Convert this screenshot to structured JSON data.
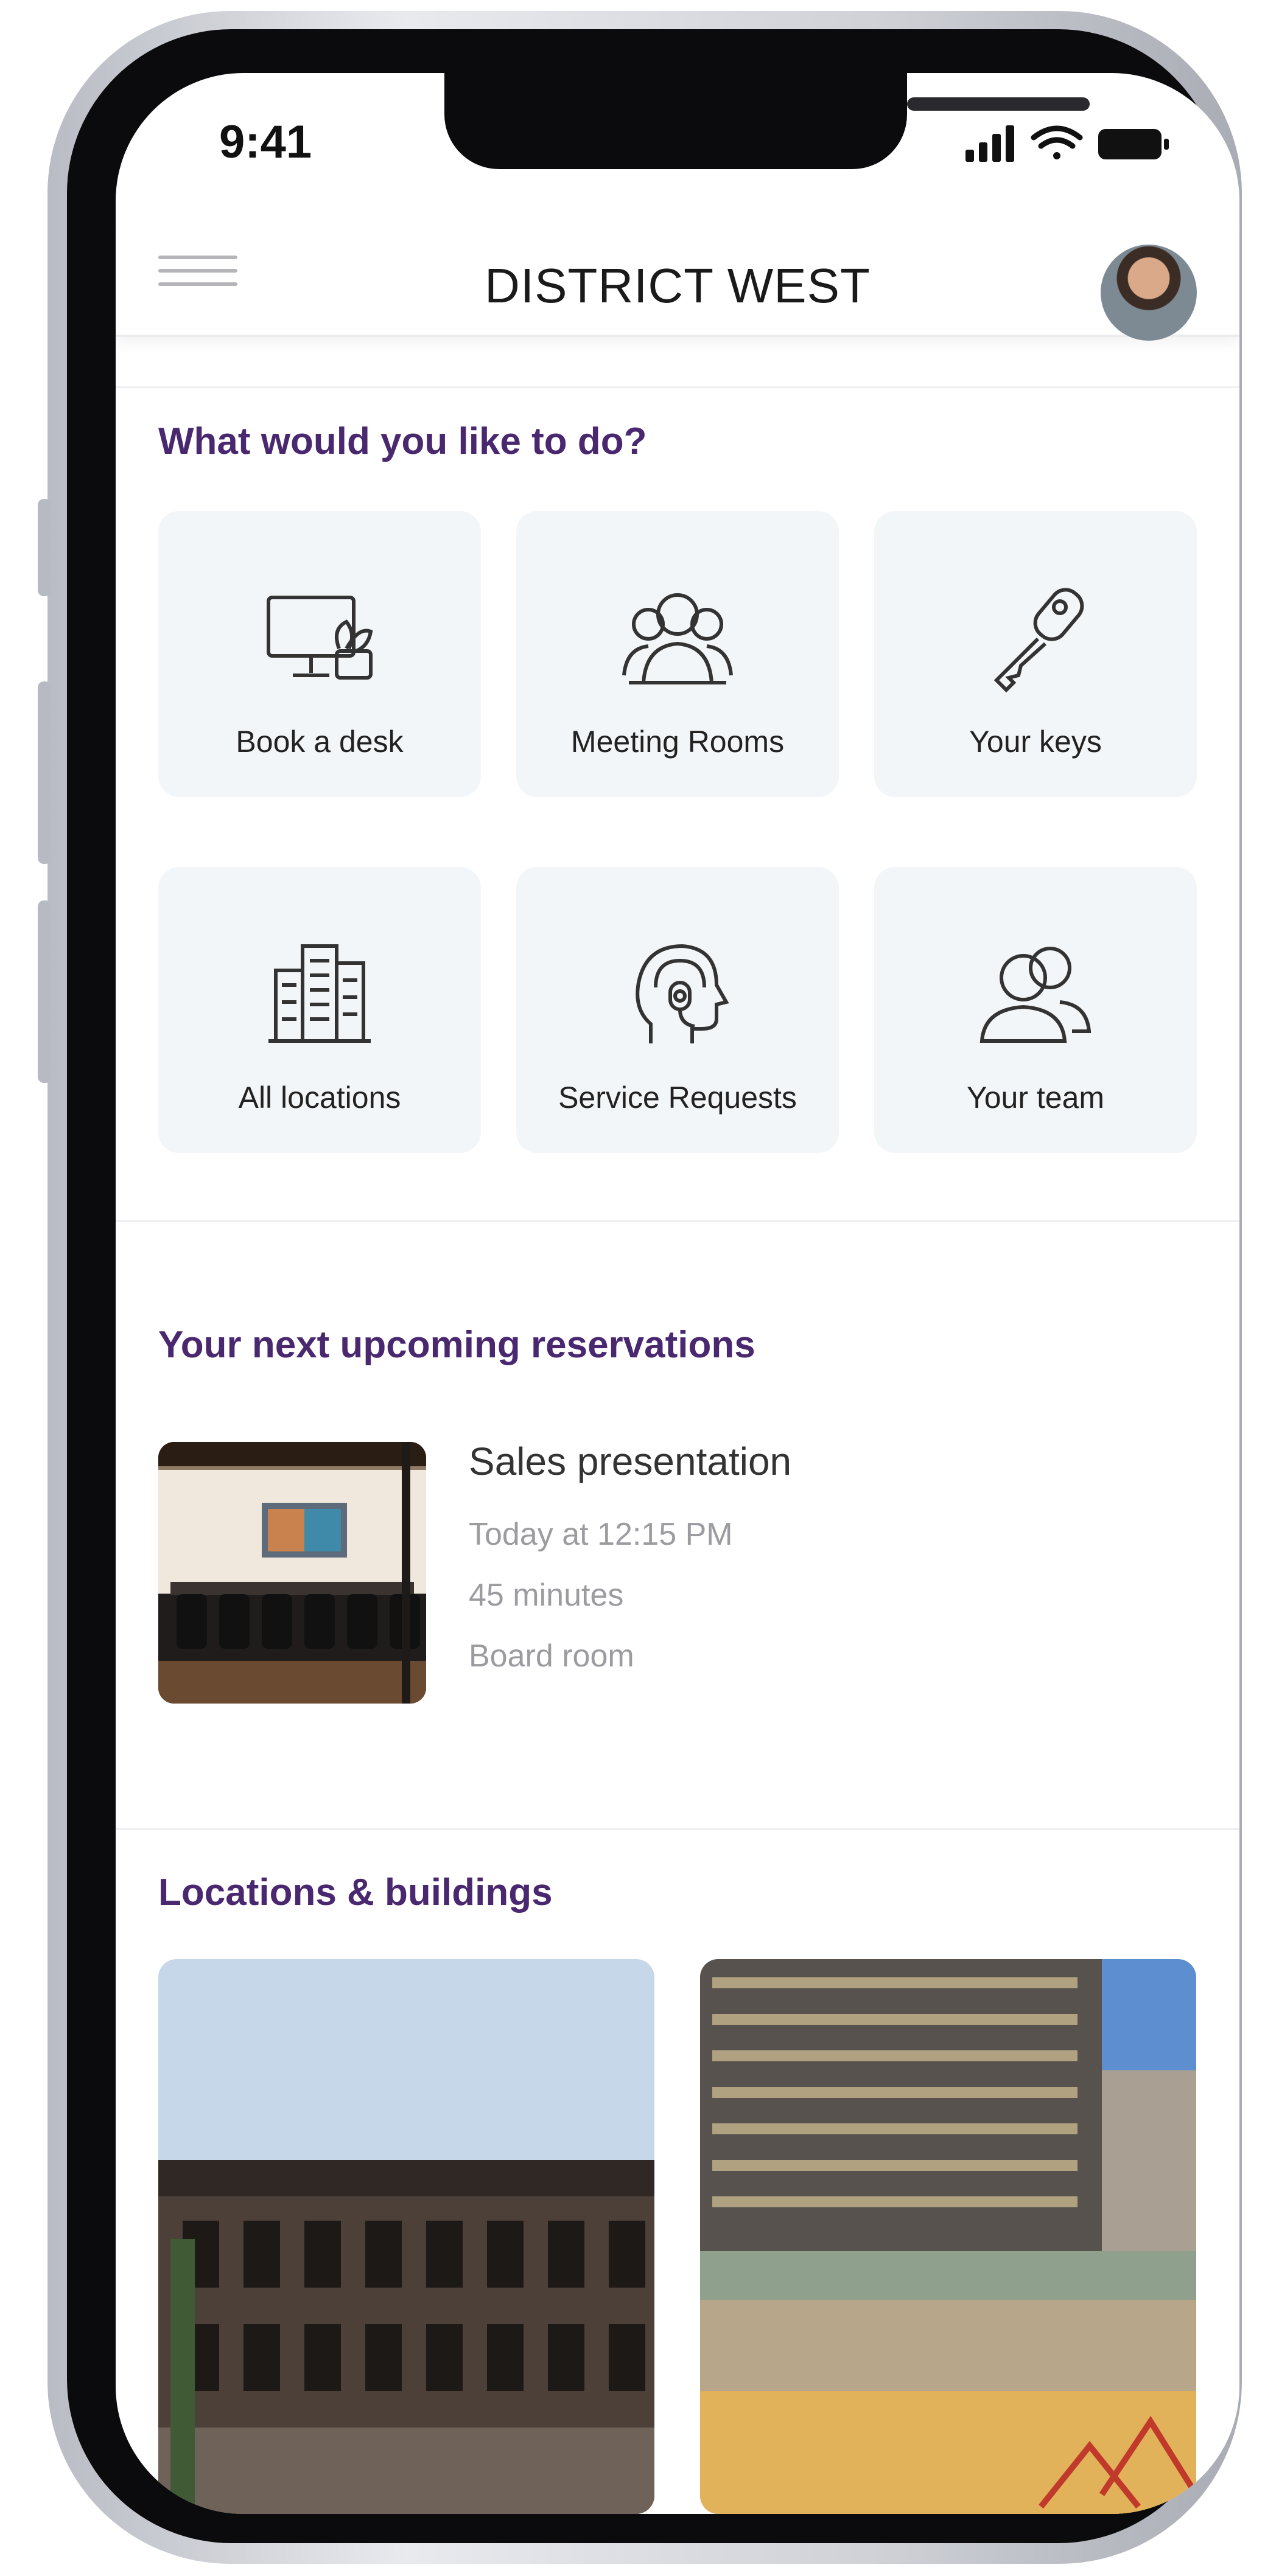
{
  "status_bar": {
    "time": "9:41"
  },
  "header": {
    "title": "DISTRICT WEST"
  },
  "actions": {
    "heading": "What would you like to do?",
    "items": [
      {
        "label": "Book a desk",
        "icon": "desk-monitor-icon"
      },
      {
        "label": "Meeting Rooms",
        "icon": "group-people-icon"
      },
      {
        "label": "Your keys",
        "icon": "key-icon"
      },
      {
        "label": "All locations",
        "icon": "buildings-icon"
      },
      {
        "label": "Service Requests",
        "icon": "headset-support-icon"
      },
      {
        "label": "Your team",
        "icon": "team-icon"
      }
    ]
  },
  "reservations": {
    "heading": "Your next upcoming reservations",
    "items": [
      {
        "title": "Sales presentation",
        "time": "Today at 12:15 PM",
        "duration": "45 minutes",
        "room": "Board room"
      }
    ]
  },
  "locations": {
    "heading": "Locations & buildings"
  },
  "colors": {
    "heading": "#4a2870",
    "tile_bg": "#f3f6f9",
    "muted_text": "#9b9ba0"
  }
}
